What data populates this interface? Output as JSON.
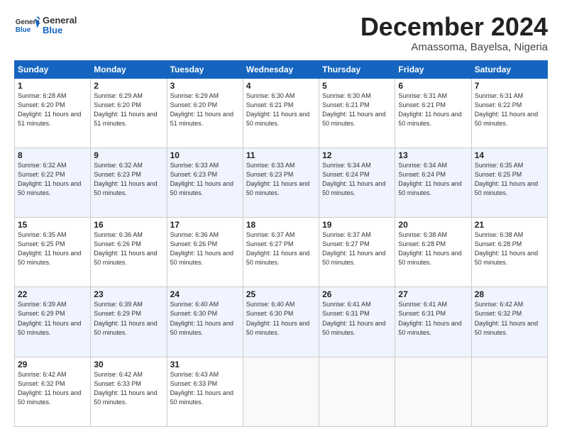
{
  "logo": {
    "text_general": "General",
    "text_blue": "Blue"
  },
  "title": "December 2024",
  "location": "Amassoma, Bayelsa, Nigeria",
  "days_of_week": [
    "Sunday",
    "Monday",
    "Tuesday",
    "Wednesday",
    "Thursday",
    "Friday",
    "Saturday"
  ],
  "weeks": [
    [
      {
        "num": "1",
        "sunrise": "6:28 AM",
        "sunset": "6:20 PM",
        "daylight": "11 hours and 51 minutes."
      },
      {
        "num": "2",
        "sunrise": "6:29 AM",
        "sunset": "6:20 PM",
        "daylight": "11 hours and 51 minutes."
      },
      {
        "num": "3",
        "sunrise": "6:29 AM",
        "sunset": "6:20 PM",
        "daylight": "11 hours and 51 minutes."
      },
      {
        "num": "4",
        "sunrise": "6:30 AM",
        "sunset": "6:21 PM",
        "daylight": "11 hours and 50 minutes."
      },
      {
        "num": "5",
        "sunrise": "6:30 AM",
        "sunset": "6:21 PM",
        "daylight": "11 hours and 50 minutes."
      },
      {
        "num": "6",
        "sunrise": "6:31 AM",
        "sunset": "6:21 PM",
        "daylight": "11 hours and 50 minutes."
      },
      {
        "num": "7",
        "sunrise": "6:31 AM",
        "sunset": "6:22 PM",
        "daylight": "11 hours and 50 minutes."
      }
    ],
    [
      {
        "num": "8",
        "sunrise": "6:32 AM",
        "sunset": "6:22 PM",
        "daylight": "11 hours and 50 minutes."
      },
      {
        "num": "9",
        "sunrise": "6:32 AM",
        "sunset": "6:23 PM",
        "daylight": "11 hours and 50 minutes."
      },
      {
        "num": "10",
        "sunrise": "6:33 AM",
        "sunset": "6:23 PM",
        "daylight": "11 hours and 50 minutes."
      },
      {
        "num": "11",
        "sunrise": "6:33 AM",
        "sunset": "6:23 PM",
        "daylight": "11 hours and 50 minutes."
      },
      {
        "num": "12",
        "sunrise": "6:34 AM",
        "sunset": "6:24 PM",
        "daylight": "11 hours and 50 minutes."
      },
      {
        "num": "13",
        "sunrise": "6:34 AM",
        "sunset": "6:24 PM",
        "daylight": "11 hours and 50 minutes."
      },
      {
        "num": "14",
        "sunrise": "6:35 AM",
        "sunset": "6:25 PM",
        "daylight": "11 hours and 50 minutes."
      }
    ],
    [
      {
        "num": "15",
        "sunrise": "6:35 AM",
        "sunset": "6:25 PM",
        "daylight": "11 hours and 50 minutes."
      },
      {
        "num": "16",
        "sunrise": "6:36 AM",
        "sunset": "6:26 PM",
        "daylight": "11 hours and 50 minutes."
      },
      {
        "num": "17",
        "sunrise": "6:36 AM",
        "sunset": "6:26 PM",
        "daylight": "11 hours and 50 minutes."
      },
      {
        "num": "18",
        "sunrise": "6:37 AM",
        "sunset": "6:27 PM",
        "daylight": "11 hours and 50 minutes."
      },
      {
        "num": "19",
        "sunrise": "6:37 AM",
        "sunset": "6:27 PM",
        "daylight": "11 hours and 50 minutes."
      },
      {
        "num": "20",
        "sunrise": "6:38 AM",
        "sunset": "6:28 PM",
        "daylight": "11 hours and 50 minutes."
      },
      {
        "num": "21",
        "sunrise": "6:38 AM",
        "sunset": "6:28 PM",
        "daylight": "11 hours and 50 minutes."
      }
    ],
    [
      {
        "num": "22",
        "sunrise": "6:39 AM",
        "sunset": "6:29 PM",
        "daylight": "11 hours and 50 minutes."
      },
      {
        "num": "23",
        "sunrise": "6:39 AM",
        "sunset": "6:29 PM",
        "daylight": "11 hours and 50 minutes."
      },
      {
        "num": "24",
        "sunrise": "6:40 AM",
        "sunset": "6:30 PM",
        "daylight": "11 hours and 50 minutes."
      },
      {
        "num": "25",
        "sunrise": "6:40 AM",
        "sunset": "6:30 PM",
        "daylight": "11 hours and 50 minutes."
      },
      {
        "num": "26",
        "sunrise": "6:41 AM",
        "sunset": "6:31 PM",
        "daylight": "11 hours and 50 minutes."
      },
      {
        "num": "27",
        "sunrise": "6:41 AM",
        "sunset": "6:31 PM",
        "daylight": "11 hours and 50 minutes."
      },
      {
        "num": "28",
        "sunrise": "6:42 AM",
        "sunset": "6:32 PM",
        "daylight": "11 hours and 50 minutes."
      }
    ],
    [
      {
        "num": "29",
        "sunrise": "6:42 AM",
        "sunset": "6:32 PM",
        "daylight": "11 hours and 50 minutes."
      },
      {
        "num": "30",
        "sunrise": "6:42 AM",
        "sunset": "6:33 PM",
        "daylight": "11 hours and 50 minutes."
      },
      {
        "num": "31",
        "sunrise": "6:43 AM",
        "sunset": "6:33 PM",
        "daylight": "11 hours and 50 minutes."
      },
      null,
      null,
      null,
      null
    ]
  ]
}
